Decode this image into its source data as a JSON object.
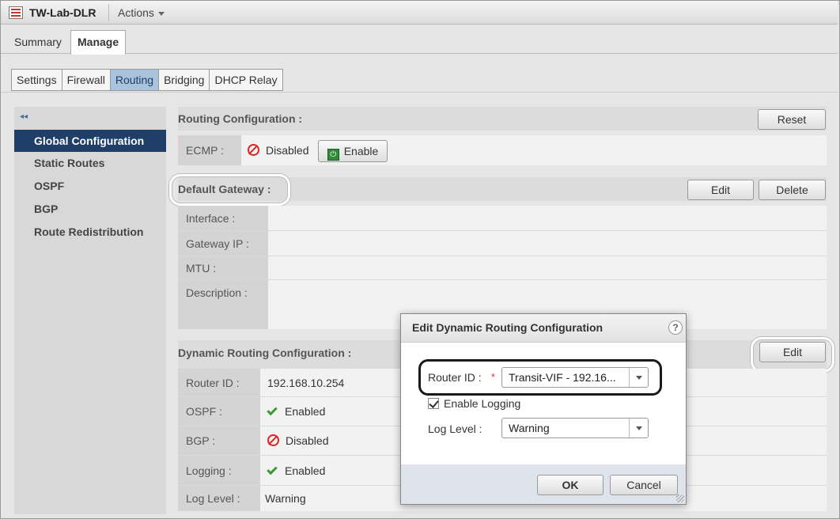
{
  "app": {
    "title": "TW-Lab-DLR",
    "actions_label": "Actions"
  },
  "main_tabs": {
    "summary": "Summary",
    "manage": "Manage"
  },
  "sub_tabs": [
    "Settings",
    "Firewall",
    "Routing",
    "Bridging",
    "DHCP Relay"
  ],
  "sidebar": {
    "collapse": "◂◂",
    "items": [
      "Global Configuration",
      "Static Routes",
      "OSPF",
      "BGP",
      "Route Redistribution"
    ]
  },
  "routing_config": {
    "title": "Routing Configuration :",
    "reset": "Reset",
    "ecmp_label": "ECMP :",
    "ecmp_status": "Disabled",
    "enable_button": "Enable"
  },
  "default_gateway": {
    "title": "Default Gateway :",
    "edit": "Edit",
    "delete": "Delete",
    "fields": [
      "Interface :",
      "Gateway IP :",
      "MTU :",
      "Description :"
    ]
  },
  "dynamic_routing": {
    "title": "Dynamic Routing Configuration :",
    "edit": "Edit",
    "rows": [
      {
        "label": "Router ID :",
        "value": "192.168.10.254"
      },
      {
        "label": "OSPF :",
        "value": "Enabled"
      },
      {
        "label": "BGP :",
        "value": "Disabled"
      },
      {
        "label": "Logging :",
        "value": "Enabled"
      },
      {
        "label": "Log Level :",
        "value": "Warning"
      }
    ]
  },
  "dialog": {
    "title": "Edit Dynamic Routing Configuration",
    "help": "?",
    "router_id_label": "Router ID :",
    "required_mark": "*",
    "router_id_value": "Transit-VIF - 192.16...",
    "enable_logging_label": "Enable Logging",
    "enable_logging_checked": true,
    "log_level_label": "Log Level :",
    "log_level_value": "Warning",
    "ok": "OK",
    "cancel": "Cancel"
  },
  "colors": {
    "nav_active_bg": "#1f3f68",
    "tab_active_bg": "#a9c3dd",
    "disabled_red": "#d22222",
    "enabled_green": "#3a9a33"
  }
}
